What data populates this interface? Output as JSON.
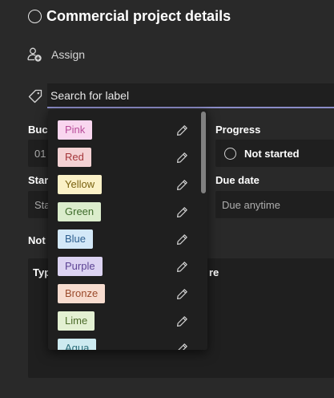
{
  "task": {
    "title": "Commercial project details"
  },
  "assign": {
    "label": "Assign"
  },
  "search": {
    "placeholder": "Search for label",
    "value": ""
  },
  "fields": {
    "bucket": {
      "label": "Buck",
      "value": "01"
    },
    "progress": {
      "label": "Progress",
      "value": "Not started"
    },
    "start_date": {
      "label": "Star",
      "value": "Sta"
    },
    "due_date": {
      "label": "Due date",
      "value": "Due anytime"
    },
    "notes": {
      "label": "Not",
      "placeholder": "Typ",
      "placeholder_tail": "re"
    }
  },
  "labels": [
    {
      "name": "Pink",
      "bg": "#f9d6ef",
      "fg": "#b84d9a"
    },
    {
      "name": "Red",
      "bg": "#f4d2d4",
      "fg": "#a4373a"
    },
    {
      "name": "Yellow",
      "bg": "#fbf1c7",
      "fg": "#7a6210"
    },
    {
      "name": "Green",
      "bg": "#dbedcc",
      "fg": "#3e6b2a"
    },
    {
      "name": "Blue",
      "bg": "#d3e8f8",
      "fg": "#2d5f8f"
    },
    {
      "name": "Purple",
      "bg": "#dcd3f2",
      "fg": "#5c4394"
    },
    {
      "name": "Bronze",
      "bg": "#f7dccf",
      "fg": "#9b4b2c"
    },
    {
      "name": "Lime",
      "bg": "#e3f0d2",
      "fg": "#4c6b2a"
    },
    {
      "name": "Aqua",
      "bg": "#cdeaf0",
      "fg": "#2a6d7a"
    }
  ],
  "icons": {
    "task_status": "circle-icon",
    "assign": "add-person-icon",
    "label": "tag-icon",
    "edit": "pencil-icon",
    "progress": "circle-icon"
  },
  "colors": {
    "background": "#292929",
    "field": "#1f1f1f",
    "accent": "#8b8cc7"
  }
}
